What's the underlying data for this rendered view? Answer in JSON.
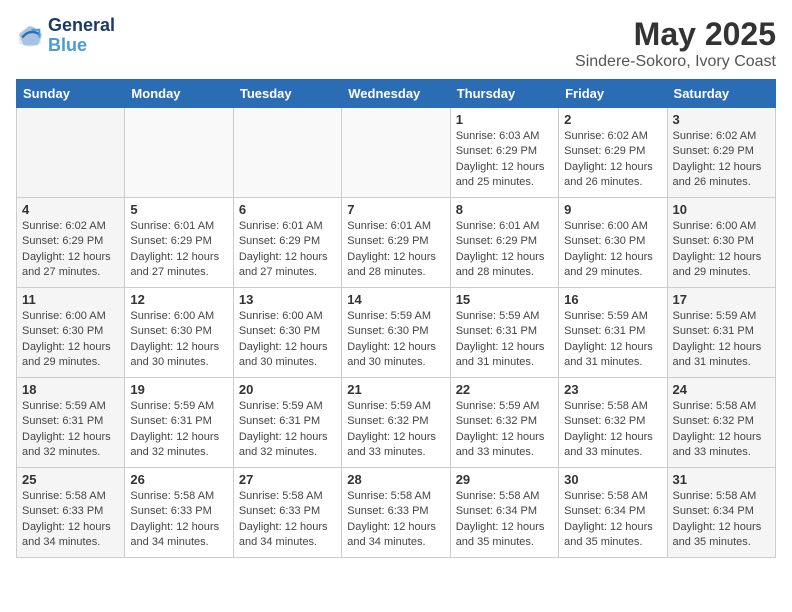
{
  "logo": {
    "line1": "General",
    "line2": "Blue"
  },
  "title": "May 2025",
  "subtitle": "Sindere-Sokoro, Ivory Coast",
  "weekdays": [
    "Sunday",
    "Monday",
    "Tuesday",
    "Wednesday",
    "Thursday",
    "Friday",
    "Saturday"
  ],
  "weeks": [
    [
      {
        "day": "",
        "info": ""
      },
      {
        "day": "",
        "info": ""
      },
      {
        "day": "",
        "info": ""
      },
      {
        "day": "",
        "info": ""
      },
      {
        "day": "1",
        "info": "Sunrise: 6:03 AM\nSunset: 6:29 PM\nDaylight: 12 hours\nand 25 minutes."
      },
      {
        "day": "2",
        "info": "Sunrise: 6:02 AM\nSunset: 6:29 PM\nDaylight: 12 hours\nand 26 minutes."
      },
      {
        "day": "3",
        "info": "Sunrise: 6:02 AM\nSunset: 6:29 PM\nDaylight: 12 hours\nand 26 minutes."
      }
    ],
    [
      {
        "day": "4",
        "info": "Sunrise: 6:02 AM\nSunset: 6:29 PM\nDaylight: 12 hours\nand 27 minutes."
      },
      {
        "day": "5",
        "info": "Sunrise: 6:01 AM\nSunset: 6:29 PM\nDaylight: 12 hours\nand 27 minutes."
      },
      {
        "day": "6",
        "info": "Sunrise: 6:01 AM\nSunset: 6:29 PM\nDaylight: 12 hours\nand 27 minutes."
      },
      {
        "day": "7",
        "info": "Sunrise: 6:01 AM\nSunset: 6:29 PM\nDaylight: 12 hours\nand 28 minutes."
      },
      {
        "day": "8",
        "info": "Sunrise: 6:01 AM\nSunset: 6:29 PM\nDaylight: 12 hours\nand 28 minutes."
      },
      {
        "day": "9",
        "info": "Sunrise: 6:00 AM\nSunset: 6:30 PM\nDaylight: 12 hours\nand 29 minutes."
      },
      {
        "day": "10",
        "info": "Sunrise: 6:00 AM\nSunset: 6:30 PM\nDaylight: 12 hours\nand 29 minutes."
      }
    ],
    [
      {
        "day": "11",
        "info": "Sunrise: 6:00 AM\nSunset: 6:30 PM\nDaylight: 12 hours\nand 29 minutes."
      },
      {
        "day": "12",
        "info": "Sunrise: 6:00 AM\nSunset: 6:30 PM\nDaylight: 12 hours\nand 30 minutes."
      },
      {
        "day": "13",
        "info": "Sunrise: 6:00 AM\nSunset: 6:30 PM\nDaylight: 12 hours\nand 30 minutes."
      },
      {
        "day": "14",
        "info": "Sunrise: 5:59 AM\nSunset: 6:30 PM\nDaylight: 12 hours\nand 30 minutes."
      },
      {
        "day": "15",
        "info": "Sunrise: 5:59 AM\nSunset: 6:31 PM\nDaylight: 12 hours\nand 31 minutes."
      },
      {
        "day": "16",
        "info": "Sunrise: 5:59 AM\nSunset: 6:31 PM\nDaylight: 12 hours\nand 31 minutes."
      },
      {
        "day": "17",
        "info": "Sunrise: 5:59 AM\nSunset: 6:31 PM\nDaylight: 12 hours\nand 31 minutes."
      }
    ],
    [
      {
        "day": "18",
        "info": "Sunrise: 5:59 AM\nSunset: 6:31 PM\nDaylight: 12 hours\nand 32 minutes."
      },
      {
        "day": "19",
        "info": "Sunrise: 5:59 AM\nSunset: 6:31 PM\nDaylight: 12 hours\nand 32 minutes."
      },
      {
        "day": "20",
        "info": "Sunrise: 5:59 AM\nSunset: 6:31 PM\nDaylight: 12 hours\nand 32 minutes."
      },
      {
        "day": "21",
        "info": "Sunrise: 5:59 AM\nSunset: 6:32 PM\nDaylight: 12 hours\nand 33 minutes."
      },
      {
        "day": "22",
        "info": "Sunrise: 5:59 AM\nSunset: 6:32 PM\nDaylight: 12 hours\nand 33 minutes."
      },
      {
        "day": "23",
        "info": "Sunrise: 5:58 AM\nSunset: 6:32 PM\nDaylight: 12 hours\nand 33 minutes."
      },
      {
        "day": "24",
        "info": "Sunrise: 5:58 AM\nSunset: 6:32 PM\nDaylight: 12 hours\nand 33 minutes."
      }
    ],
    [
      {
        "day": "25",
        "info": "Sunrise: 5:58 AM\nSunset: 6:33 PM\nDaylight: 12 hours\nand 34 minutes."
      },
      {
        "day": "26",
        "info": "Sunrise: 5:58 AM\nSunset: 6:33 PM\nDaylight: 12 hours\nand 34 minutes."
      },
      {
        "day": "27",
        "info": "Sunrise: 5:58 AM\nSunset: 6:33 PM\nDaylight: 12 hours\nand 34 minutes."
      },
      {
        "day": "28",
        "info": "Sunrise: 5:58 AM\nSunset: 6:33 PM\nDaylight: 12 hours\nand 34 minutes."
      },
      {
        "day": "29",
        "info": "Sunrise: 5:58 AM\nSunset: 6:34 PM\nDaylight: 12 hours\nand 35 minutes."
      },
      {
        "day": "30",
        "info": "Sunrise: 5:58 AM\nSunset: 6:34 PM\nDaylight: 12 hours\nand 35 minutes."
      },
      {
        "day": "31",
        "info": "Sunrise: 5:58 AM\nSunset: 6:34 PM\nDaylight: 12 hours\nand 35 minutes."
      }
    ]
  ]
}
